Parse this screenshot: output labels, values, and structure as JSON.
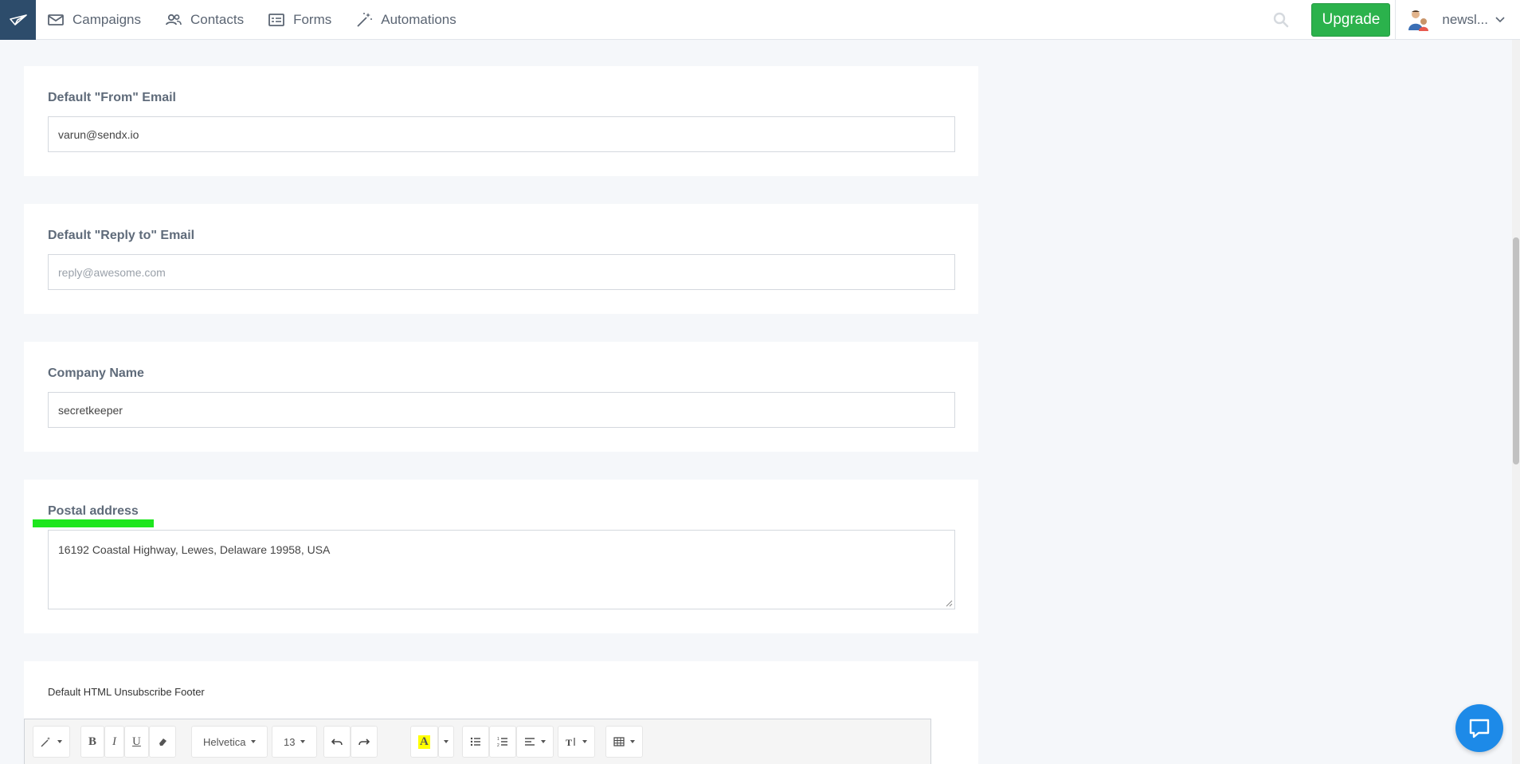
{
  "nav": {
    "items": [
      {
        "label": "Campaigns",
        "icon": "mail-icon"
      },
      {
        "label": "Contacts",
        "icon": "people-icon"
      },
      {
        "label": "Forms",
        "icon": "form-icon"
      },
      {
        "label": "Automations",
        "icon": "magic-wand-icon"
      }
    ],
    "upgrade_label": "Upgrade",
    "account_label": "newsl..."
  },
  "fields": {
    "from_email": {
      "label": "Default \"From\" Email",
      "value": "varun@sendx.io"
    },
    "reply_to": {
      "label": "Default \"Reply to\" Email",
      "placeholder": "reply@awesome.com"
    },
    "company": {
      "label": "Company Name",
      "value": "secretkeeper"
    },
    "postal": {
      "label": "Postal address",
      "value": "16192 Coastal Highway, Lewes, Delaware 19958, USA"
    },
    "footer": {
      "label": "Default HTML Unsubscribe Footer"
    }
  },
  "editor": {
    "font_family": "Helvetica",
    "font_size": "13"
  },
  "colors": {
    "brand": "#2d4c6b",
    "upgrade": "#2bb24c",
    "highlight": "#1ee61e",
    "chat": "#1d8ae8"
  }
}
